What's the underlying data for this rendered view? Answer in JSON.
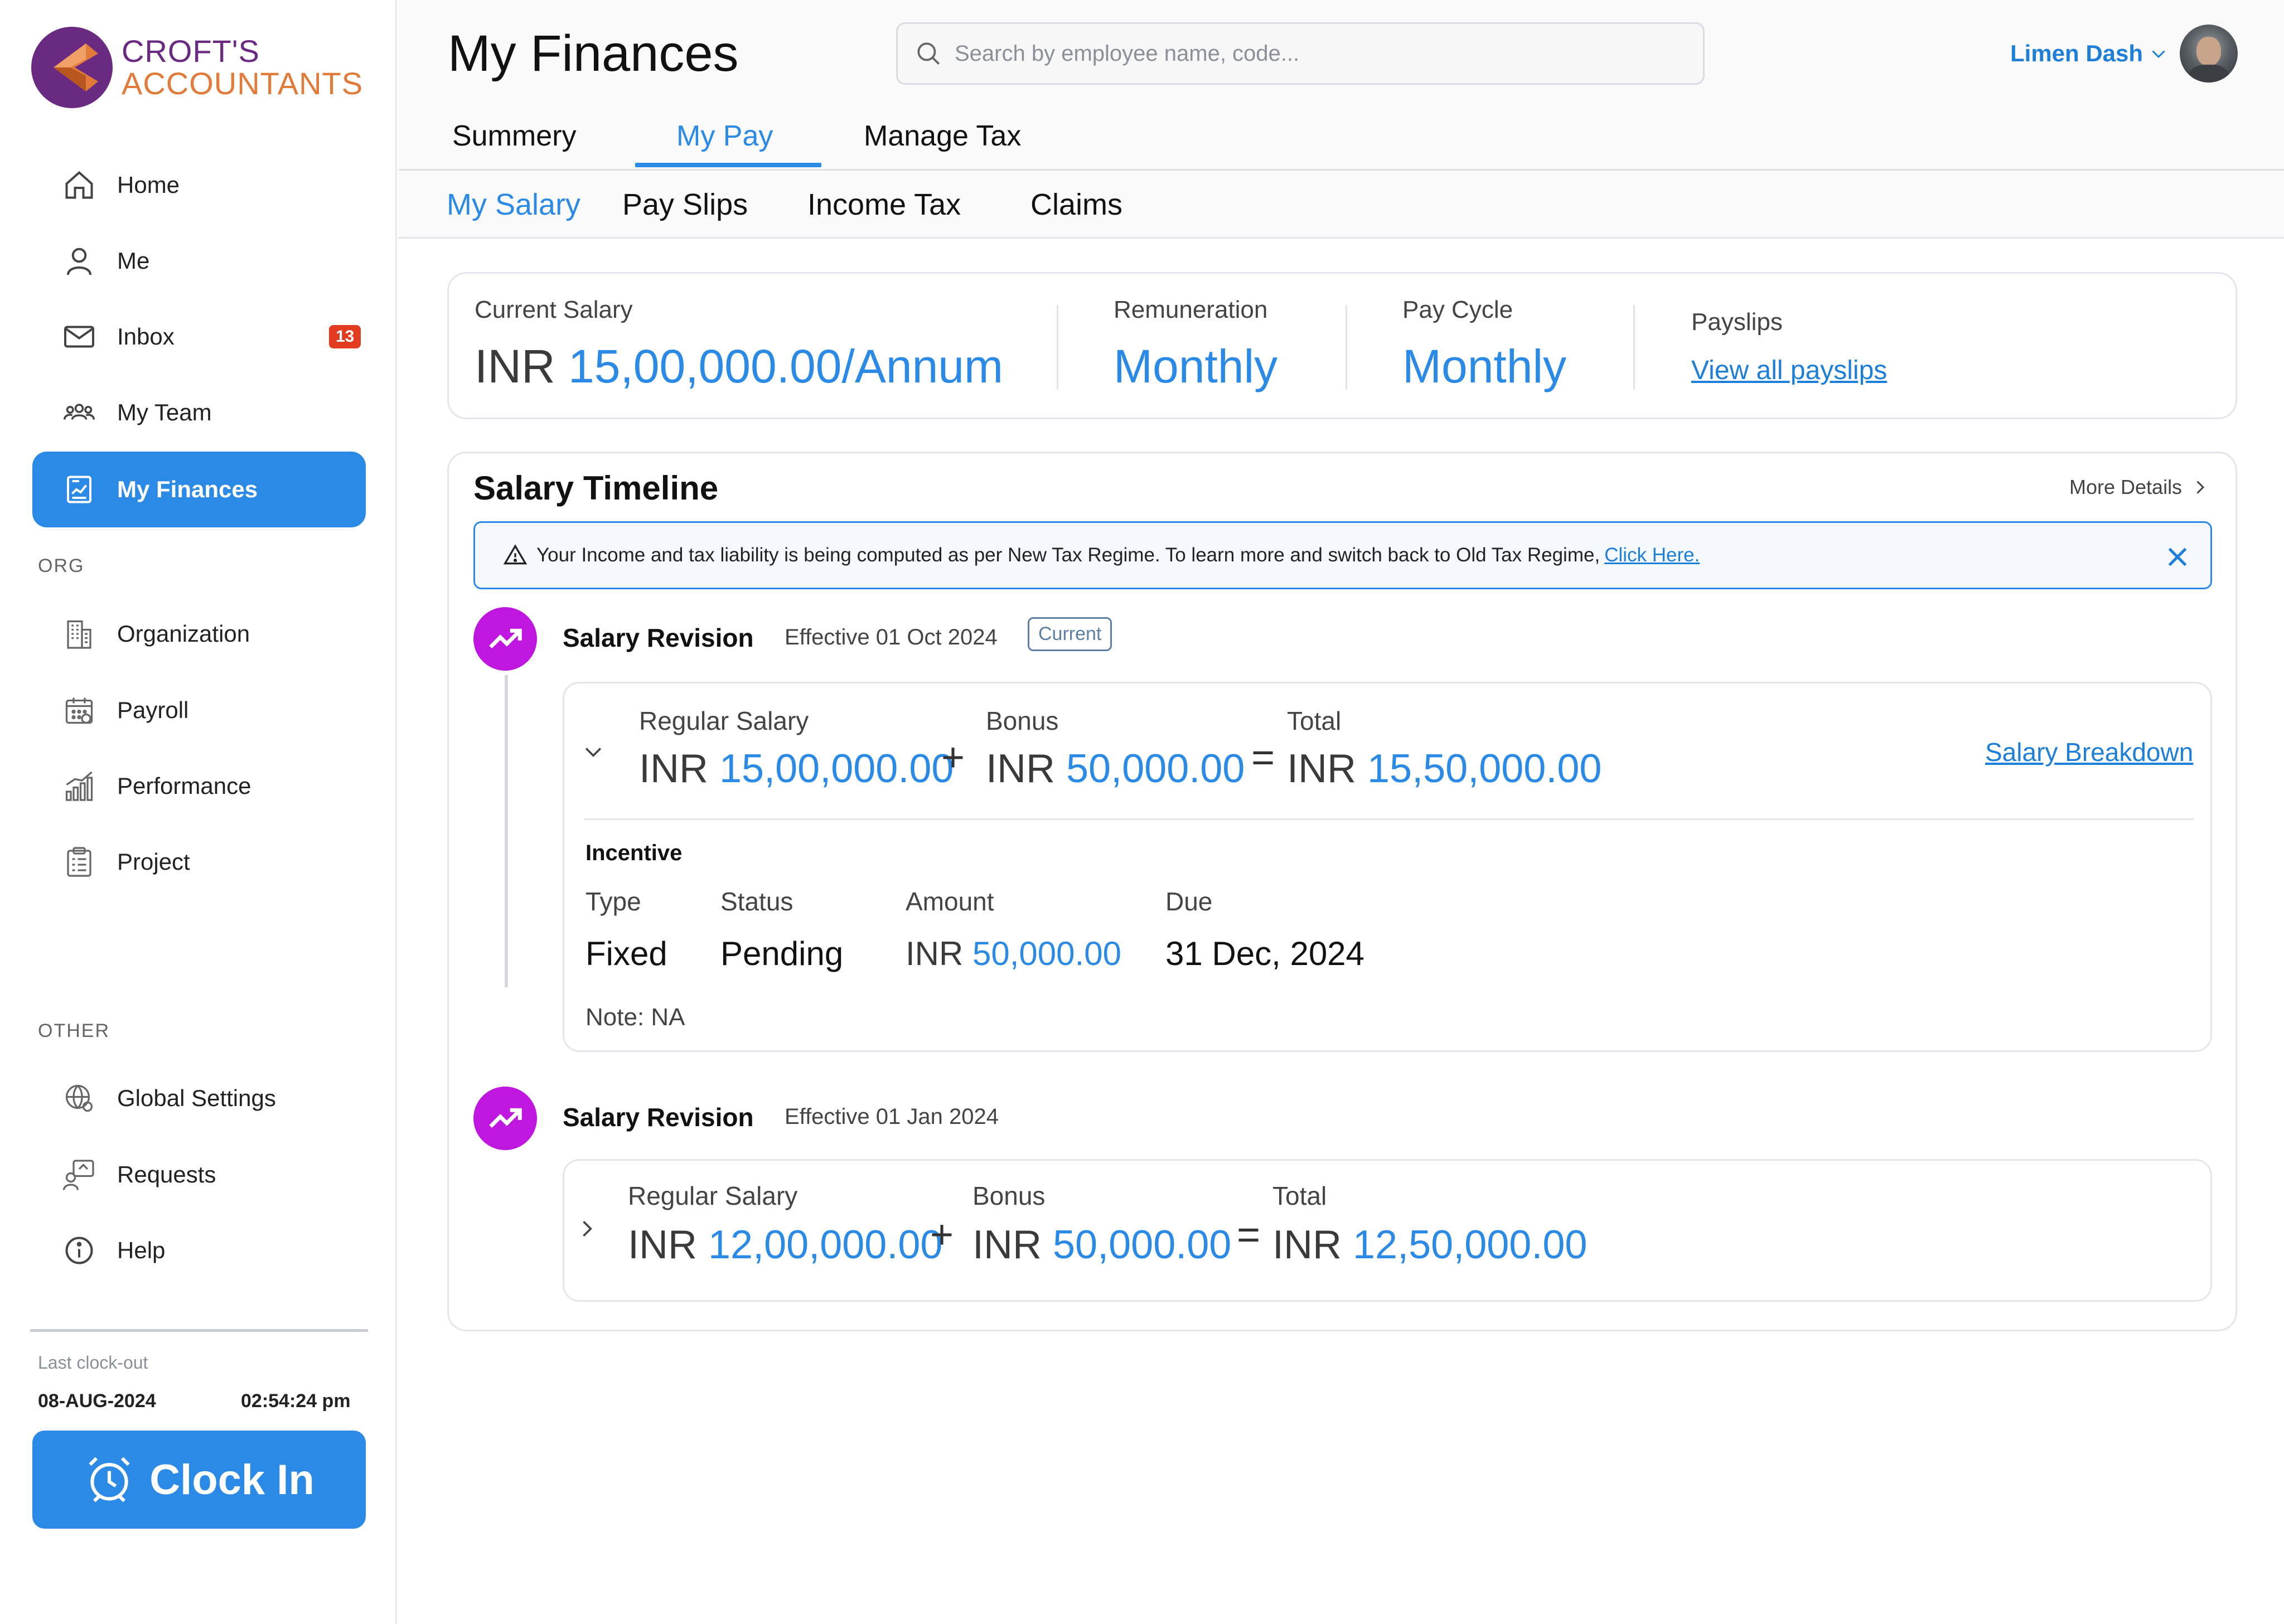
{
  "brand": {
    "line1": "CROFT'S",
    "line2": "ACCOUNTANTS",
    "colors": {
      "purple": "#6a2a82",
      "orange": "#e27b3a"
    }
  },
  "sidebar": {
    "items": [
      {
        "label": "Home",
        "icon": "home-icon"
      },
      {
        "label": "Me",
        "icon": "user-icon"
      },
      {
        "label": "Inbox",
        "icon": "mail-icon",
        "badge": "13"
      },
      {
        "label": "My Team",
        "icon": "team-icon"
      },
      {
        "label": "My Finances",
        "icon": "finance-icon",
        "active": true
      }
    ],
    "org_label": "ORG",
    "org_items": [
      {
        "label": "Organization",
        "icon": "building-icon"
      },
      {
        "label": "Payroll",
        "icon": "calendar-icon"
      },
      {
        "label": "Performance",
        "icon": "bar-chart-icon"
      },
      {
        "label": "Project",
        "icon": "clipboard-icon"
      }
    ],
    "other_label": "OTHER",
    "other_items": [
      {
        "label": "Global Settings",
        "icon": "globe-gear-icon"
      },
      {
        "label": "Requests",
        "icon": "request-icon"
      },
      {
        "label": "Help",
        "icon": "info-icon"
      }
    ],
    "clock": {
      "label": "Last clock-out",
      "date": "08-AUG-2024",
      "time": "02:54:24 pm",
      "button": "Clock In"
    }
  },
  "header": {
    "title": "My Finances",
    "search_placeholder": "Search by employee name, code...",
    "user_name": "Limen Dash",
    "tabs": [
      "Summery",
      "My Pay",
      "Manage Tax"
    ],
    "active_tab": "My Pay",
    "subtabs": [
      "My Salary",
      "Pay Slips",
      "Income Tax",
      "Claims"
    ],
    "active_subtab": "My Salary"
  },
  "summary": {
    "current_salary_label": "Current Salary",
    "current_salary_currency": "INR",
    "current_salary_value": "15,00,000.00/Annum",
    "remuneration_label": "Remuneration",
    "remuneration_value": "Monthly",
    "pay_cycle_label": "Pay Cycle",
    "pay_cycle_value": "Monthly",
    "payslips_label": "Payslips",
    "payslips_link": "View all payslips"
  },
  "timeline": {
    "title": "Salary Timeline",
    "more": "More Details",
    "banner_text": "Your Income and tax liability is being computed as per New Tax Regime. To learn more and switch back to Old Tax Regime,",
    "banner_link": "Click Here.",
    "revisions": [
      {
        "title": "Salary Revision",
        "effective": "Effective 01 Oct 2024",
        "badge": "Current",
        "regular_label": "Regular Salary",
        "regular_currency": "INR",
        "regular_value": "15,00,000.00",
        "bonus_label": "Bonus",
        "bonus_currency": "INR",
        "bonus_value": "50,000.00",
        "total_label": "Total",
        "total_currency": "INR",
        "total_value": "15,50,000.00",
        "breakdown_link": "Salary Breakdown",
        "incentive": {
          "title": "Incentive",
          "type_label": "Type",
          "type_value": "Fixed",
          "status_label": "Status",
          "status_value": "Pending",
          "amount_label": "Amount",
          "amount_currency": "INR",
          "amount_value": "50,000.00",
          "due_label": "Due",
          "due_value": "31 Dec, 2024",
          "note": "Note: NA"
        }
      },
      {
        "title": "Salary Revision",
        "effective": "Effective 01 Jan 2024",
        "regular_label": "Regular Salary",
        "regular_currency": "INR",
        "regular_value": "12,00,000.00",
        "bonus_label": "Bonus",
        "bonus_currency": "INR",
        "bonus_value": "50,000.00",
        "total_label": "Total",
        "total_currency": "INR",
        "total_value": "12,50,000.00"
      }
    ],
    "operators": {
      "plus": "+",
      "equals": "="
    }
  },
  "theme": {
    "accent": "#2b8ae6",
    "revision_icon": "#c017e0",
    "badge": "#e23b20"
  }
}
